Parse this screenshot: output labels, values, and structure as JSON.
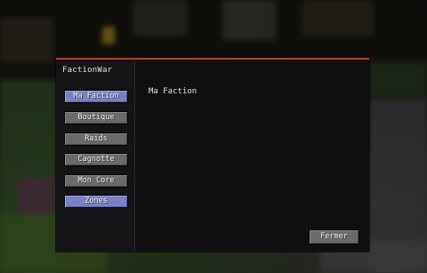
{
  "window": {
    "brand": "FactionWar",
    "accent_color": "#b5432f"
  },
  "sidebar": {
    "items": [
      {
        "label": "Ma Faction",
        "active": true
      },
      {
        "label": "Boutique",
        "active": false
      },
      {
        "label": "Raids",
        "active": false
      },
      {
        "label": "Cagnotte",
        "active": false
      },
      {
        "label": "Mon Core",
        "active": false
      },
      {
        "label": "Zones",
        "active": true
      }
    ],
    "active_color": "#7b80c4",
    "button_color": "#6a6a6a"
  },
  "content": {
    "title": "Ma Faction"
  },
  "footer": {
    "close_label": "Fermer"
  }
}
